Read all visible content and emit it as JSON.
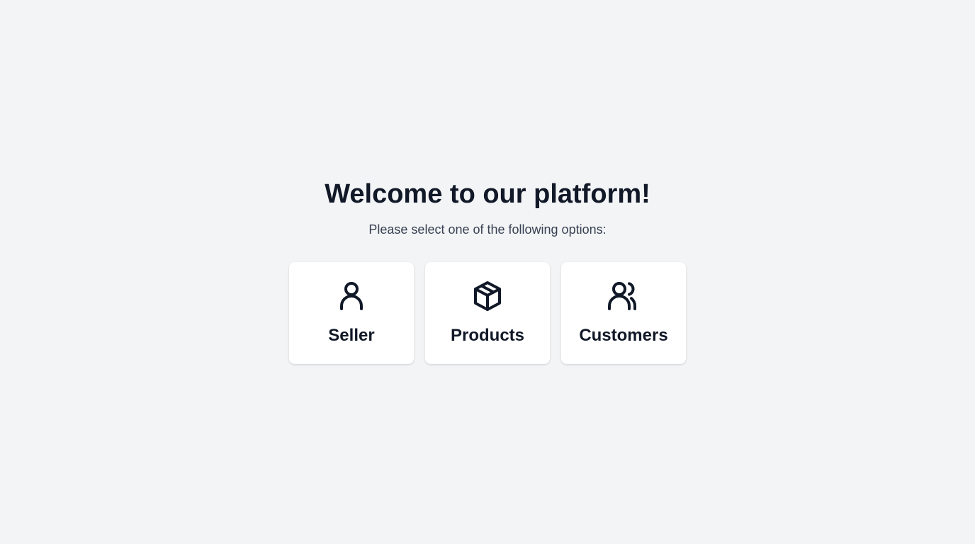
{
  "header": {
    "title": "Welcome to our platform!",
    "subtitle": "Please select one of the following options:"
  },
  "options": [
    {
      "label": "Seller",
      "icon": "user-icon"
    },
    {
      "label": "Products",
      "icon": "box-icon"
    },
    {
      "label": "Customers",
      "icon": "users-icon"
    }
  ],
  "colors": {
    "background": "#f3f4f6",
    "card": "#ffffff",
    "text": "#111827",
    "subtext": "#374151"
  }
}
